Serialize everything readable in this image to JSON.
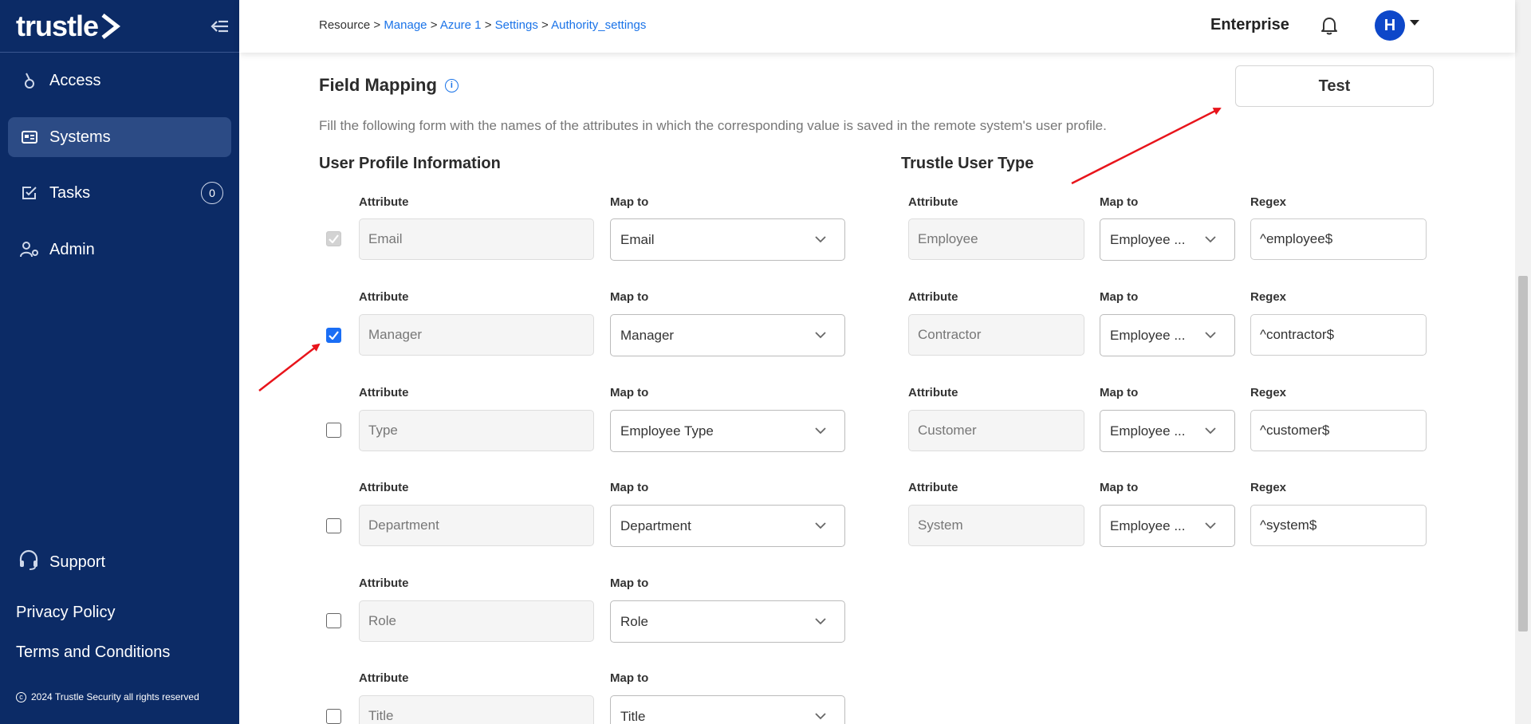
{
  "sidebar": {
    "logo": "trustle",
    "nav": [
      {
        "label": "Access",
        "icon": "access-icon"
      },
      {
        "label": "Systems",
        "icon": "systems-icon",
        "active": true
      },
      {
        "label": "Tasks",
        "icon": "tasks-icon",
        "badge": "0"
      },
      {
        "label": "Admin",
        "icon": "admin-icon"
      }
    ],
    "support": "Support",
    "privacy": "Privacy Policy",
    "terms": "Terms and Conditions",
    "copyright": "2024 Trustle Security all rights reserved"
  },
  "header": {
    "breadcrumb": [
      {
        "label": "Resource",
        "link": false
      },
      {
        "label": "Manage",
        "link": true
      },
      {
        "label": "Azure 1",
        "link": true
      },
      {
        "label": "Settings",
        "link": true
      },
      {
        "label": "Authority_settings",
        "link": true
      }
    ],
    "separator": ">",
    "org": "Enterprise",
    "avatar_initial": "H"
  },
  "main": {
    "title": "Field Mapping",
    "info_glyph": "i",
    "test_label": "Test",
    "description": "Fill the following form with the names of the attributes in which the corresponding value is saved in the remote system's user profile.",
    "profile": {
      "title": "User Profile Information",
      "attribute_label": "Attribute",
      "map_label": "Map to",
      "rows": [
        {
          "attribute": "Email",
          "map": "Email",
          "checked": true,
          "disabled": true
        },
        {
          "attribute": "Manager",
          "map": "Manager",
          "checked": true,
          "disabled": false
        },
        {
          "attribute": "Type",
          "map": "Employee Type",
          "checked": false,
          "disabled": false
        },
        {
          "attribute": "Department",
          "map": "Department",
          "checked": false,
          "disabled": false
        },
        {
          "attribute": "Role",
          "map": "Role",
          "checked": false,
          "disabled": false
        },
        {
          "attribute": "Title",
          "map": "Title",
          "checked": false,
          "disabled": false
        }
      ]
    },
    "user_type": {
      "title": "Trustle User Type",
      "attribute_label": "Attribute",
      "map_label": "Map to",
      "regex_label": "Regex",
      "rows": [
        {
          "attribute": "Employee",
          "map": "Employee ...",
          "regex": "^employee$"
        },
        {
          "attribute": "Contractor",
          "map": "Employee ...",
          "regex": "^contractor$"
        },
        {
          "attribute": "Customer",
          "map": "Employee ...",
          "regex": "^customer$"
        },
        {
          "attribute": "System",
          "map": "Employee ...",
          "regex": "^system$"
        }
      ]
    }
  },
  "colors": {
    "sidebar_bg": "#0c2b66",
    "sidebar_active": "#2c4b85",
    "link": "#1a73e8",
    "checkbox_checked": "#1a6ef5",
    "annotation_arrow": "#e8141b",
    "avatar_bg": "#0d47c9"
  }
}
